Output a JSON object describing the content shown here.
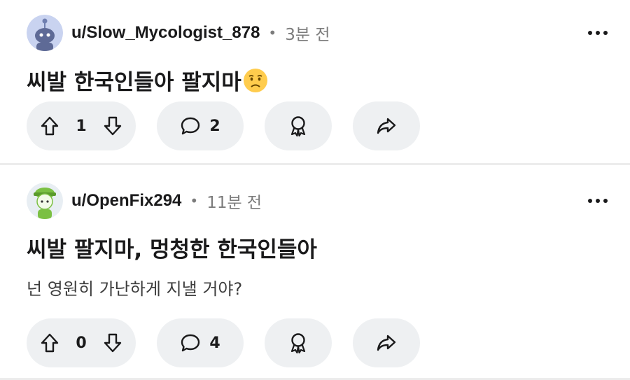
{
  "posts": [
    {
      "username": "u/Slow_Mycologist_878",
      "separator": "•",
      "time": "3분 전",
      "title": "씨발 한국인들아 팔지마",
      "title_emoji": "worried-face-emoji",
      "body": "",
      "votes": "1",
      "comments": "2",
      "avatar": "snoo-avatar-grey-blue"
    },
    {
      "username": "u/OpenFix294",
      "separator": "•",
      "time": "11분 전",
      "title": "씨발 팔지마, 멍청한 한국인들아",
      "body": "넌 영원히 가난하게 지낼 거야?",
      "votes": "0",
      "comments": "4",
      "avatar": "snoo-avatar-green-cap"
    }
  ],
  "icons": {
    "upvote": "arrow-up-icon",
    "downvote": "arrow-down-icon",
    "comment": "speech-bubble-icon",
    "award": "award-icon",
    "share": "share-arrow-icon",
    "more": "more-horizontal-icon"
  },
  "colors": {
    "pill_bg": "#eef0f2",
    "meta_grey": "#7c7c7c",
    "text": "#1a1a1b"
  }
}
